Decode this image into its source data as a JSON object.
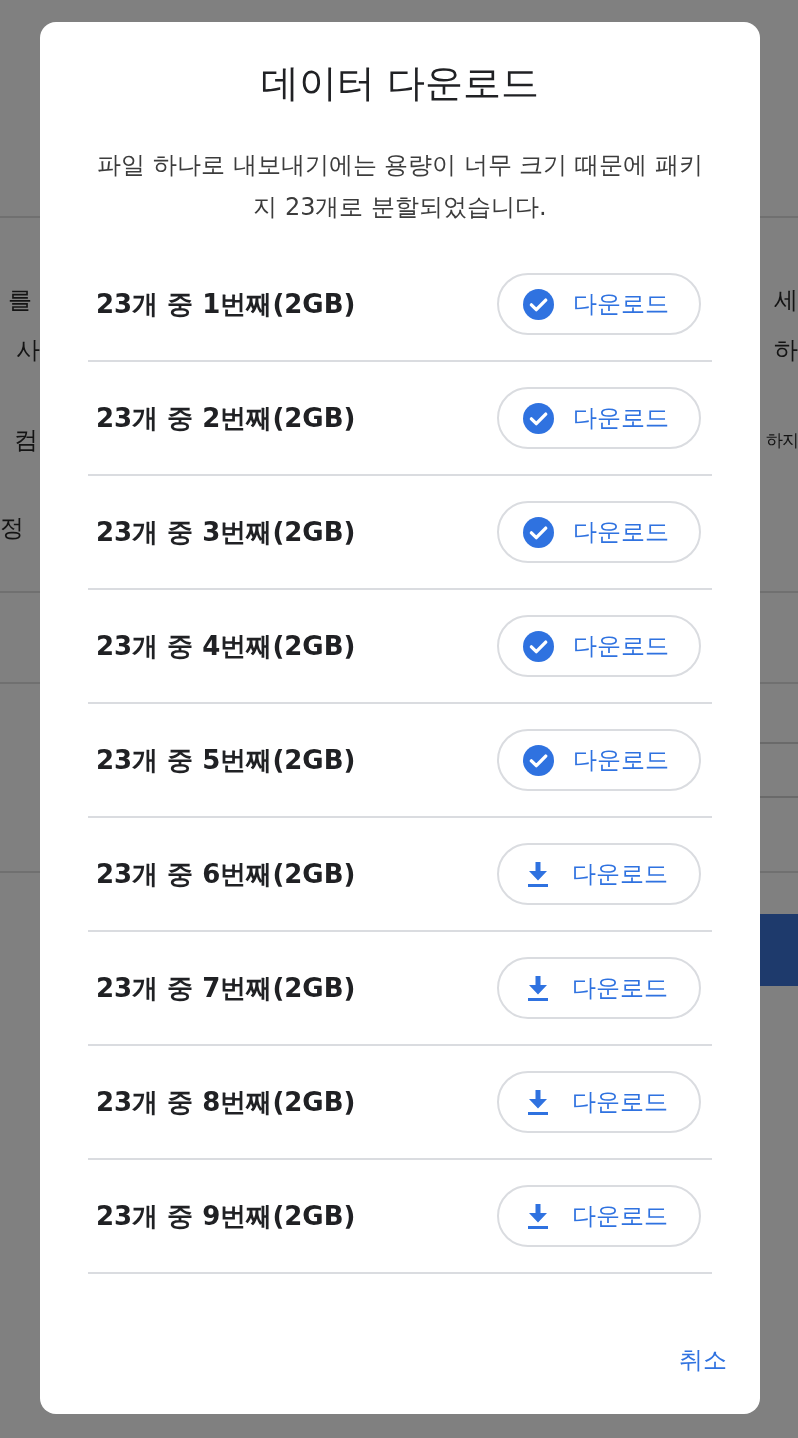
{
  "background": {
    "lines": [
      {
        "left": "를",
        "right": "세"
      },
      {
        "left": "사",
        "right": "하"
      },
      {
        "left": "컴",
        "right": "하지"
      },
      {
        "left": "정"
      }
    ]
  },
  "dialog": {
    "title": "데이터 다운로드",
    "description": "파일 하나로 내보내기에는 용량이 너무 크기 때문에 패키지 23개로 분할되었습니다.",
    "parts": [
      {
        "label": "23개 중 1번째(2GB)",
        "button": "다운로드",
        "downloaded": true
      },
      {
        "label": "23개 중 2번째(2GB)",
        "button": "다운로드",
        "downloaded": true
      },
      {
        "label": "23개 중 3번째(2GB)",
        "button": "다운로드",
        "downloaded": true
      },
      {
        "label": "23개 중 4번째(2GB)",
        "button": "다운로드",
        "downloaded": true
      },
      {
        "label": "23개 중 5번째(2GB)",
        "button": "다운로드",
        "downloaded": true
      },
      {
        "label": "23개 중 6번째(2GB)",
        "button": "다운로드",
        "downloaded": false
      },
      {
        "label": "23개 중 7번째(2GB)",
        "button": "다운로드",
        "downloaded": false
      },
      {
        "label": "23개 중 8번째(2GB)",
        "button": "다운로드",
        "downloaded": false
      },
      {
        "label": "23개 중 9번째(2GB)",
        "button": "다운로드",
        "downloaded": false
      }
    ],
    "cancel": "취소"
  }
}
